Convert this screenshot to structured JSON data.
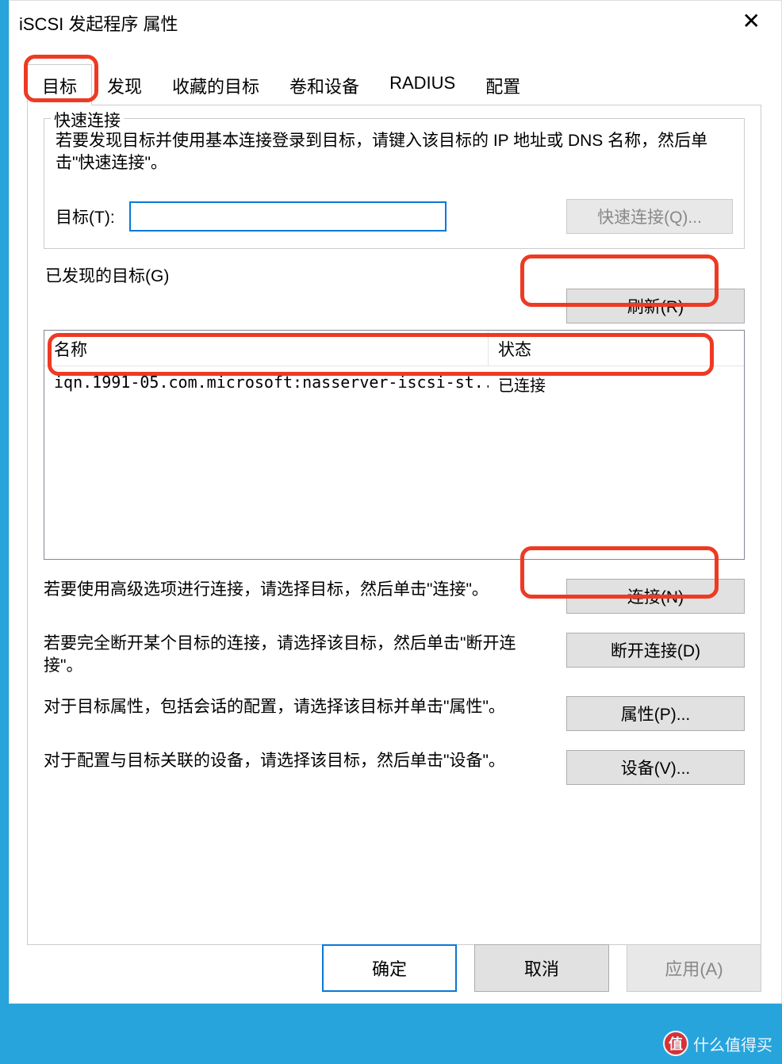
{
  "window": {
    "title": "iSCSI 发起程序 属性"
  },
  "tabs": {
    "items": [
      {
        "label": "目标",
        "active": true
      },
      {
        "label": "发现"
      },
      {
        "label": "收藏的目标"
      },
      {
        "label": "卷和设备"
      },
      {
        "label": "RADIUS"
      },
      {
        "label": "配置"
      }
    ]
  },
  "quick_connect": {
    "legend": "快速连接",
    "help": "若要发现目标并使用基本连接登录到目标，请键入该目标的 IP 地址或 DNS 名称，然后单击\"快速连接\"。",
    "target_label": "目标(T):",
    "target_value": "",
    "button": "快速连接(Q)..."
  },
  "discovered": {
    "header": "已发现的目标(G)",
    "refresh": "刷新(R)",
    "columns": {
      "name": "名称",
      "status": "状态"
    },
    "rows": [
      {
        "name": "iqn.1991-05.com.microsoft:nasserver-iscsi-st...",
        "status": "已连接"
      }
    ]
  },
  "actions": {
    "connect": {
      "text": "若要使用高级选项进行连接，请选择目标，然后单击\"连接\"。",
      "button": "连接(N)"
    },
    "disconnect": {
      "text": "若要完全断开某个目标的连接，请选择该目标，然后单击\"断开连接\"。",
      "button": "断开连接(D)"
    },
    "properties": {
      "text": "对于目标属性，包括会话的配置，请选择该目标并单击\"属性\"。",
      "button": "属性(P)..."
    },
    "devices": {
      "text": "对于配置与目标关联的设备，请选择该目标，然后单击\"设备\"。",
      "button": "设备(V)..."
    }
  },
  "buttons": {
    "ok": "确定",
    "cancel": "取消",
    "apply": "应用(A)"
  },
  "watermark": {
    "badge": "值",
    "text": "什么值得买"
  }
}
